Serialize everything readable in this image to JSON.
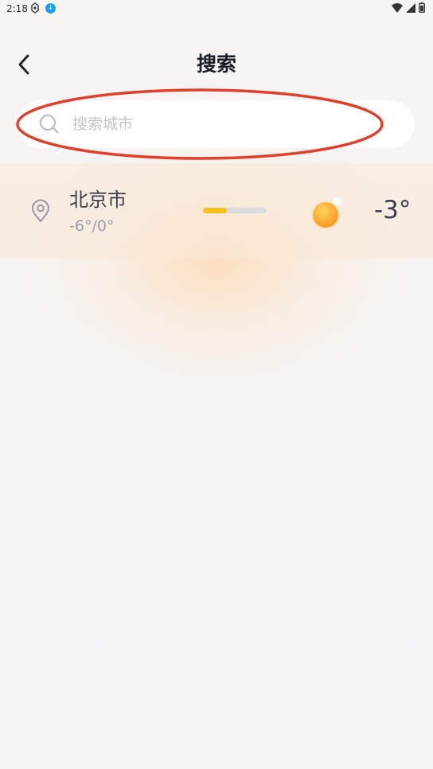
{
  "status_bar": {
    "time": "2:18",
    "icons": [
      "vpn-key-icon",
      "download-icon",
      "wifi-icon",
      "signal-icon",
      "battery-icon"
    ]
  },
  "header": {
    "title": "搜索",
    "back_icon": "chevron-left-icon"
  },
  "search": {
    "placeholder": "搜索城市",
    "value": "",
    "icon": "search-icon"
  },
  "annotation": {
    "shape": "ellipse",
    "color": "#e0402b"
  },
  "city_list": [
    {
      "name": "北京市",
      "range": "-6°/0°",
      "current_temp": "-3°",
      "weather_icon": "sun-icon",
      "bar_fill_fraction": 0.37
    }
  ],
  "colors": {
    "accent_yellow": "#f5c21c",
    "sun_orange": "#f6a024",
    "title": "#1c1d2b"
  }
}
